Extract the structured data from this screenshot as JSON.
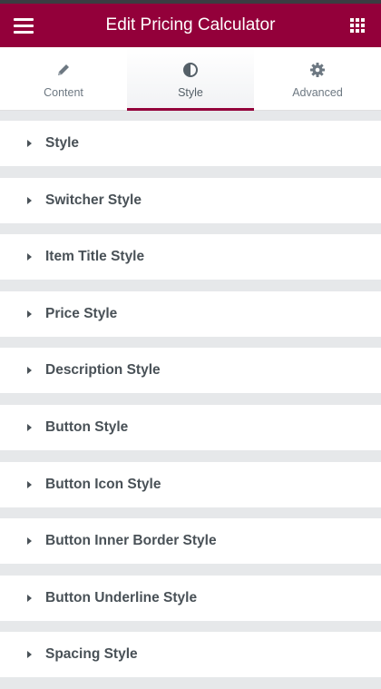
{
  "header": {
    "title": "Edit Pricing Calculator",
    "menu_icon": "hamburger-icon",
    "apps_icon": "grid-icon",
    "brand_color": "#93003a"
  },
  "tabs": [
    {
      "label": "Content",
      "icon": "pencil-icon",
      "active": false
    },
    {
      "label": "Style",
      "icon": "half-circle-contrast-icon",
      "active": true
    },
    {
      "label": "Advanced",
      "icon": "gear-icon",
      "active": false
    }
  ],
  "sections": [
    {
      "label": "Style"
    },
    {
      "label": "Switcher Style"
    },
    {
      "label": "Item Title Style"
    },
    {
      "label": "Price Style"
    },
    {
      "label": "Description Style"
    },
    {
      "label": "Button Style"
    },
    {
      "label": "Button Icon Style"
    },
    {
      "label": "Button Inner Border Style"
    },
    {
      "label": "Button Underline Style"
    },
    {
      "label": "Spacing Style"
    }
  ]
}
